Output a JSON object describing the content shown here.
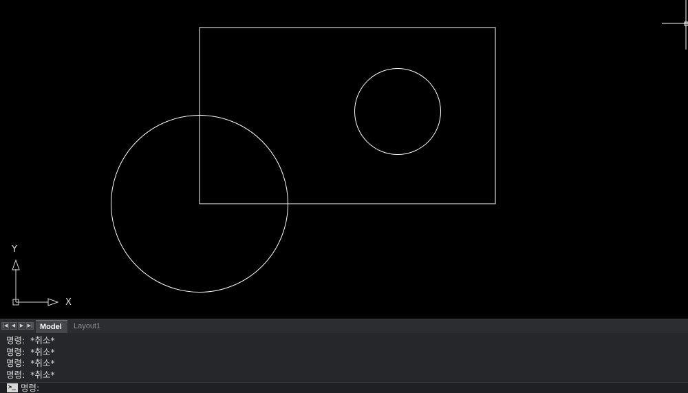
{
  "colors": {
    "canvas_background": "#000000",
    "drawing_stroke": "#ffffff",
    "tabbar_background": "#2b2d31",
    "command_background": "#25272b",
    "text": "#d8d8d8"
  },
  "ucs": {
    "x_label": "X",
    "y_label": "Y"
  },
  "tabs": {
    "nav_icons": [
      "first-icon",
      "prev-icon",
      "next-icon",
      "last-icon"
    ],
    "model_label": "Model",
    "layout1_label": "Layout1",
    "active": "Model"
  },
  "command_history": {
    "lines": [
      "명령:  *취소*",
      "명령:  *취소*",
      "명령:  *취소*",
      "명령:  *취소*"
    ]
  },
  "command_line": {
    "prompt": "명령:",
    "value": ""
  }
}
